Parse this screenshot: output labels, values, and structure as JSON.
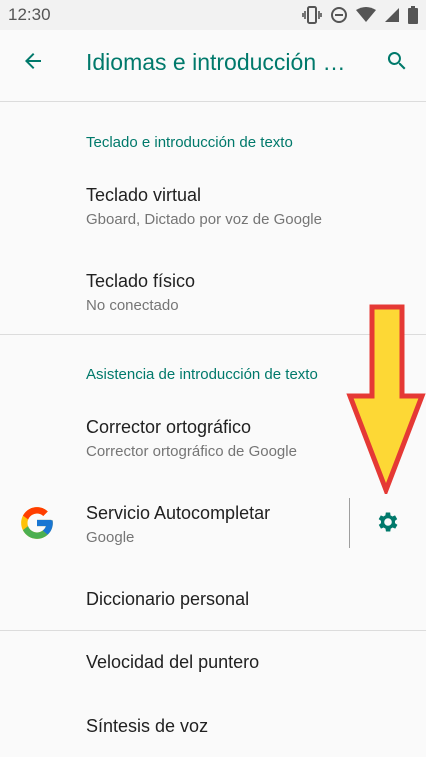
{
  "status_bar": {
    "time": "12:30",
    "icons": [
      "vibrate-icon",
      "dnd-icon",
      "wifi-icon",
      "signal-icon",
      "battery-icon"
    ]
  },
  "app_bar": {
    "title": "Idiomas e introducción de texto",
    "back_icon": "arrow-back-icon",
    "search_icon": "search-icon"
  },
  "sections": [
    {
      "header": "Teclado e introducción de texto",
      "items": [
        {
          "title": "Teclado virtual",
          "subtitle": "Gboard, Dictado por voz de Google"
        },
        {
          "title": "Teclado físico",
          "subtitle": "No conectado"
        }
      ]
    },
    {
      "header": "Asistencia de introducción de texto",
      "items": [
        {
          "title": "Corrector ortográfico",
          "subtitle": "Corrector ortográfico de Google"
        },
        {
          "title": "Servicio Autocompletar",
          "subtitle": "Google",
          "icon": "google-logo",
          "action_icon": "gear-icon"
        },
        {
          "title": "Diccionario personal"
        }
      ]
    },
    {
      "items": [
        {
          "title": "Velocidad del puntero"
        },
        {
          "title": "Síntesis de voz"
        }
      ]
    }
  ],
  "colors": {
    "accent": "#00796b",
    "arrow_fill": "#fdd835",
    "arrow_stroke": "#e53935"
  }
}
